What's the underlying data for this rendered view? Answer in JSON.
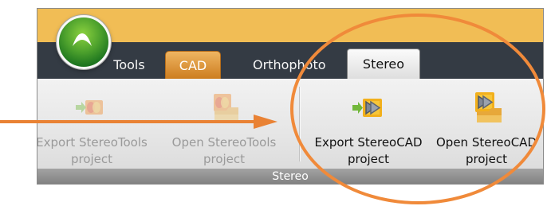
{
  "ribbon": {
    "app_button_icon": "up-arrow-icon",
    "tabs": [
      {
        "label": "Tools"
      },
      {
        "label": "CAD"
      },
      {
        "label": "Orthophoto"
      },
      {
        "label": "Stereo"
      }
    ],
    "group_label": "Stereo",
    "commands": [
      {
        "line1": "Export StereoTools",
        "line2": "project",
        "icon": "export-stereotools-icon",
        "enabled": false
      },
      {
        "line1": "Open StereoTools",
        "line2": "project",
        "icon": "open-stereotools-icon",
        "enabled": false
      },
      {
        "line1": "Export StereoCAD",
        "line2": "project",
        "icon": "export-stereocad-icon",
        "enabled": true
      },
      {
        "line1": "Open StereoCAD",
        "line2": "project",
        "icon": "open-stereocad-icon",
        "enabled": true
      }
    ]
  },
  "annotations": {
    "accent_color": "#f08a3a"
  }
}
